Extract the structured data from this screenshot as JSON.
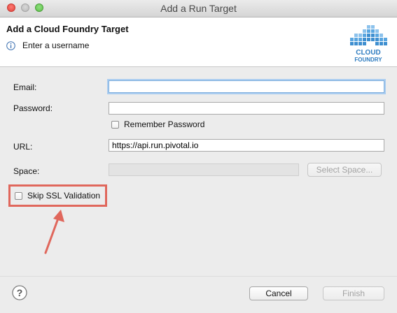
{
  "window": {
    "title": "Add a Run Target"
  },
  "header": {
    "title": "Add a Cloud Foundry Target",
    "message": "Enter a username",
    "logo": {
      "line1": "CLOUD",
      "line2": "FOUNDRY"
    }
  },
  "form": {
    "email": {
      "label": "Email:",
      "value": ""
    },
    "password": {
      "label": "Password:",
      "value": ""
    },
    "remember_password": {
      "label": "Remember Password",
      "checked": false
    },
    "url": {
      "label": "URL:",
      "value": "https://api.run.pivotal.io"
    },
    "space": {
      "label": "Space:",
      "value": "",
      "select_button": "Select Space..."
    },
    "skip_ssl": {
      "label": "Skip SSL Validation",
      "checked": false
    }
  },
  "footer": {
    "cancel": "Cancel",
    "finish": "Finish"
  },
  "colors": {
    "annotation": "#e0675c",
    "focus": "#7eaedd",
    "cf_blue": "#3f8fd0"
  },
  "icons": [
    "info-icon",
    "help-icon",
    "cloud-foundry-logo",
    "arrow-annotation"
  ]
}
